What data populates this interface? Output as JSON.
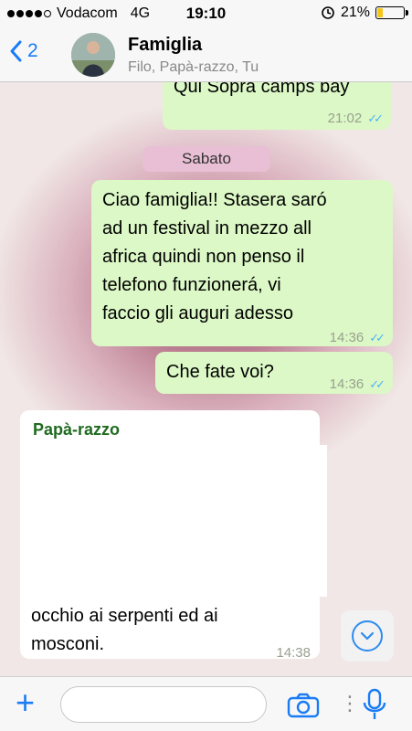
{
  "status_bar": {
    "carrier": "Vodacom",
    "network": "4G",
    "time": "19:10",
    "battery": "21%",
    "battery_level": 0.21,
    "signal_bars": 4
  },
  "header": {
    "back_count": "2",
    "title": "Famiglia",
    "participants": "Filo, Papà-razzo, Tu"
  },
  "chat": {
    "messages": [
      {
        "text": "Qui Sopra camps bay",
        "time": "21:02"
      },
      {
        "text": "Ciao famiglia!! Stasera saró ad un festival in mezzo all africa quindi non penso il telefono funzionerá, vi faccio gli auguri adesso",
        "time": "14:36"
      },
      {
        "text": "Che fate voi?",
        "time": "14:36"
      },
      {
        "sender": "Papà-razzo",
        "text": "occhio ai serpenti  ed ai mosconi.",
        "time": "14:38"
      }
    ],
    "date_separator": "Sabato",
    "message1_lines": [
      "Ciao famiglia!! Stasera saró",
      "ad un festival in mezzo all",
      "africa quindi non penso il",
      "telefono funzionerá, vi",
      "faccio gli auguri adesso"
    ],
    "message3_lines": [
      "occhio ai serpenti  ed ai",
      "mosconi."
    ]
  },
  "input_bar": {
    "placeholder": ""
  },
  "colors": {
    "accent": "#1a7cf5",
    "outgoing_bubble": "#dcf8c6",
    "incoming_bubble": "#ffffff",
    "read_ticks": "#4fb3f6",
    "sender_name": "#1f6b1f"
  },
  "icons": [
    "back-chevron-icon",
    "double-check-icon",
    "scroll-down-icon",
    "plus-icon",
    "camera-icon",
    "microphone-icon",
    "alarm-icon"
  ]
}
